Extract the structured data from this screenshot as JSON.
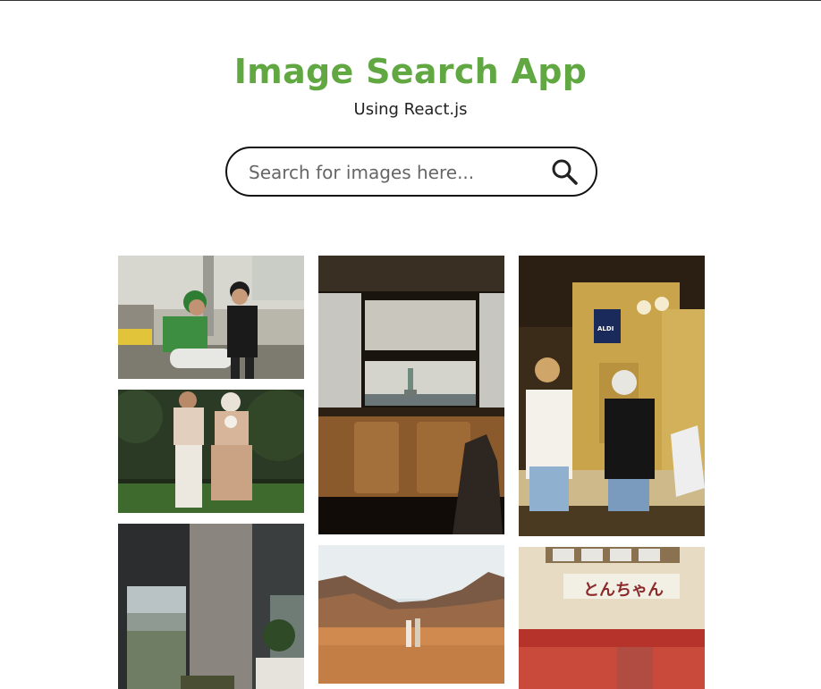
{
  "header": {
    "title": "Image Search App",
    "subtitle": "Using React.js"
  },
  "search": {
    "placeholder": "Search for images here...",
    "value": "",
    "icon": "search-icon"
  },
  "colors": {
    "title": "#61a843",
    "border": "#111111"
  },
  "gallery": {
    "images": [
      {
        "alt": "Two men with a green scooter on a city street"
      },
      {
        "alt": "Couple standing on grass holding hands"
      },
      {
        "alt": "Modern interior with window and concrete pillar"
      },
      {
        "alt": "Statue of Liberty seen through a ferry window"
      },
      {
        "alt": "Two people walking in a desert canyon"
      },
      {
        "alt": "Two young men in a yellow hallway",
        "sign": "ALDI"
      },
      {
        "alt": "Japanese storefront with sign",
        "sign": "とんちゃん"
      }
    ]
  }
}
